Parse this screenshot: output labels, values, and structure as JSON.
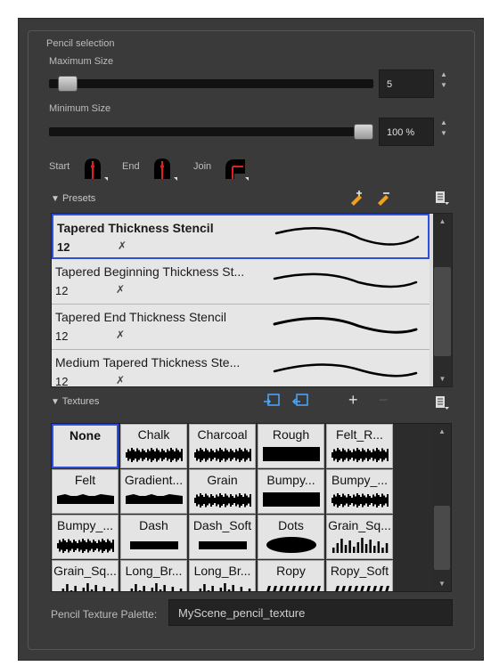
{
  "group_title": "Pencil selection",
  "max_size": {
    "label": "Maximum Size",
    "value": "5",
    "level": 0.03
  },
  "min_size": {
    "label": "Minimum Size",
    "value": "100 %",
    "level": 1.0
  },
  "tips": {
    "start_label": "Start",
    "end_label": "End",
    "join_label": "Join"
  },
  "presets": {
    "header": "Presets",
    "items": [
      {
        "name": "Tapered Thickness Stencil",
        "size": "12",
        "selected": true
      },
      {
        "name": "Tapered Beginning Thickness St...",
        "size": "12",
        "selected": false
      },
      {
        "name": "Tapered End Thickness Stencil",
        "size": "12",
        "selected": false
      },
      {
        "name": "Medium Tapered Thickness Ste...",
        "size": "12",
        "selected": false
      }
    ]
  },
  "textures": {
    "header": "Textures",
    "items": [
      {
        "name": "None",
        "selected": true
      },
      {
        "name": "Chalk"
      },
      {
        "name": "Charcoal"
      },
      {
        "name": "Rough"
      },
      {
        "name": "Felt_R..."
      },
      {
        "name": "Felt"
      },
      {
        "name": "Gradient..."
      },
      {
        "name": "Grain"
      },
      {
        "name": "Bumpy..."
      },
      {
        "name": "Bumpy_..."
      },
      {
        "name": "Bumpy_..."
      },
      {
        "name": "Dash"
      },
      {
        "name": "Dash_Soft"
      },
      {
        "name": "Dots"
      },
      {
        "name": "Grain_Sq..."
      },
      {
        "name": "Grain_Sq..."
      },
      {
        "name": "Long_Br..."
      },
      {
        "name": "Long_Br..."
      },
      {
        "name": "Ropy"
      },
      {
        "name": "Ropy_Soft"
      }
    ]
  },
  "palette": {
    "label": "Pencil Texture Palette:",
    "value": "MyScene_pencil_texture"
  },
  "colors": {
    "panel": "#3a3a3a",
    "selection": "#2f4fe0",
    "tip_red": "#e02020"
  }
}
